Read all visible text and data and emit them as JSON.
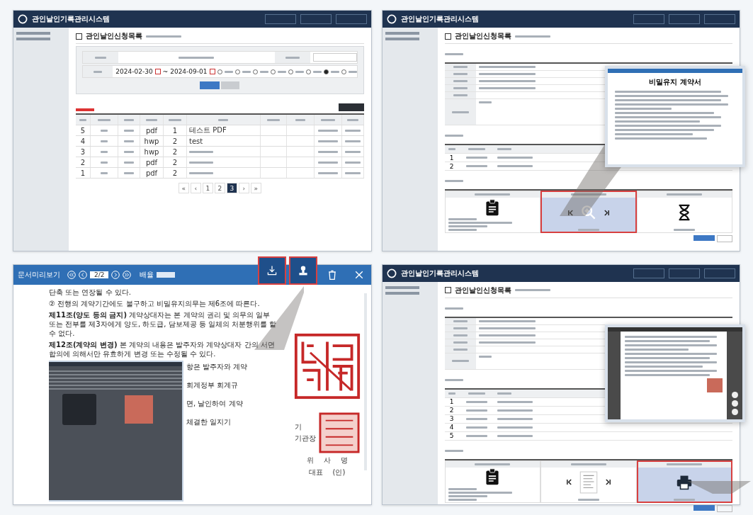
{
  "list_screen": {
    "app_title": "관인날인기록관리시스템",
    "page_title": "관인날인신청목록",
    "date_from": "2024-02-30",
    "date_separator": "~",
    "date_to": "2024-09-01",
    "period_options": [
      {
        "selected": false
      },
      {
        "selected": false
      },
      {
        "selected": false
      },
      {
        "selected": false
      },
      {
        "selected": false
      },
      {
        "selected": false
      },
      {
        "selected": true
      },
      {
        "selected": false
      }
    ],
    "rows": [
      {
        "no": "5",
        "type": "pdf",
        "pages": "1",
        "title": "테스트 PDF"
      },
      {
        "no": "4",
        "type": "hwp",
        "pages": "2",
        "title": "test"
      },
      {
        "no": "3",
        "type": "hwp",
        "pages": "2"
      },
      {
        "no": "2",
        "type": "pdf",
        "pages": "2"
      },
      {
        "no": "1",
        "type": "pdf",
        "pages": "2"
      }
    ],
    "pagination": [
      {
        "label": "«",
        "selected": false
      },
      {
        "label": "‹",
        "selected": false
      },
      {
        "label": "1",
        "selected": false
      },
      {
        "label": "2",
        "selected": false
      },
      {
        "label": "3",
        "selected": true
      },
      {
        "label": "›",
        "selected": false
      },
      {
        "label": "»",
        "selected": false
      }
    ]
  },
  "detail_screen": {
    "app_title": "관인날인기록관리시스템",
    "page_title": "관인날인신청목록",
    "history": [
      {
        "no": "1"
      },
      {
        "no": "2"
      }
    ],
    "steps": [
      {
        "kind": "clipboard",
        "highlighted": false
      },
      {
        "kind": "magnifier",
        "highlighted": true
      },
      {
        "kind": "hourglass",
        "highlighted": false
      }
    ],
    "popup": {
      "doc_title": "비밀유지 계약서"
    }
  },
  "viewer_screen": {
    "title": "문서미리보기",
    "page": "2/2",
    "zoom_label": "배율",
    "tools": [
      {
        "kind": "download",
        "highlighted": true
      },
      {
        "kind": "stamp",
        "highlighted": true
      },
      {
        "kind": "trash",
        "highlighted": false
      },
      {
        "kind": "close",
        "highlighted": false
      }
    ],
    "paragraphs": [
      "단축 또는 연장될 수 있다.",
      "② 전행의 계약기간에도 불구하고 비밀유지의무는 제6조에 따른다.",
      "**제11조(양도 등의 금지)** 계약상대자는 본 계약의 권리 및 의무의 일부 또는 전부를 제3자에게 양도, 하도급, 담보제공 등 일체의 처분행위를 할 수 없다.",
      "**제12조(계약의 변경)** 본 계약의 내용은 발주자와 계약상대자 간의 서면 합의에 의해서만 유효하게 변경 또는 수정될 수 있다."
    ],
    "peek_lines": [
      "항은 발주자와 계약",
      "회계정부 회계규",
      "면, 날인하여 계약",
      "체결한 일지기"
    ],
    "seal_side": [
      "기",
      "기관장"
    ],
    "seal_bottom": [
      "위",
      "사",
      "명"
    ],
    "seal_bottom2": [
      "대표",
      "(인)"
    ]
  },
  "print_screen": {
    "app_title": "관인날인기록관리시스템",
    "page_title": "관인날인신청목록",
    "history": [
      {
        "no": "1"
      },
      {
        "no": "2"
      },
      {
        "no": "3"
      },
      {
        "no": "4"
      },
      {
        "no": "5"
      }
    ],
    "steps": [
      {
        "kind": "clipboard",
        "highlighted": false
      },
      {
        "kind": "document",
        "highlighted": false
      },
      {
        "kind": "printer",
        "highlighted": true
      }
    ]
  }
}
